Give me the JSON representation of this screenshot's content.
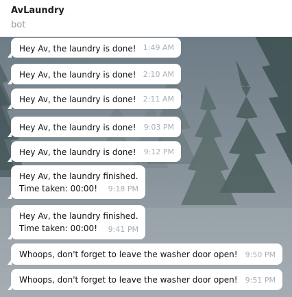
{
  "chat": {
    "title": "AvLaundry",
    "subtitle": "bot"
  },
  "messages": [
    {
      "text": "Hey Av, the laundry is done!",
      "time": "1:49 AM"
    },
    {
      "text": "Hey Av, the laundry is done!",
      "time": "2:10 AM"
    },
    {
      "text": "Hey Av, the laundry is done!",
      "time": "2:11 AM"
    },
    {
      "text": "Hey Av, the laundry is done!",
      "time": "9:03 PM"
    },
    {
      "text": "Hey Av, the laundry is done!",
      "time": "9:12 PM"
    },
    {
      "text": "Hey Av, the laundry finished.\nTime taken: 00:00!",
      "time": "9:18 PM"
    },
    {
      "text": "Hey Av, the laundry finished.\nTime taken: 00:00!",
      "time": "9:41 PM"
    },
    {
      "text": "Whoops, don't forget to leave the washer door open!",
      "time": "9:50 PM"
    },
    {
      "text": "Whoops, don't forget to leave the washer door open!",
      "time": "9:51 PM"
    }
  ],
  "colors": {
    "bubble": "#ffffff",
    "timestamp": "#a7b0b8",
    "chat_background": "#76838c"
  }
}
